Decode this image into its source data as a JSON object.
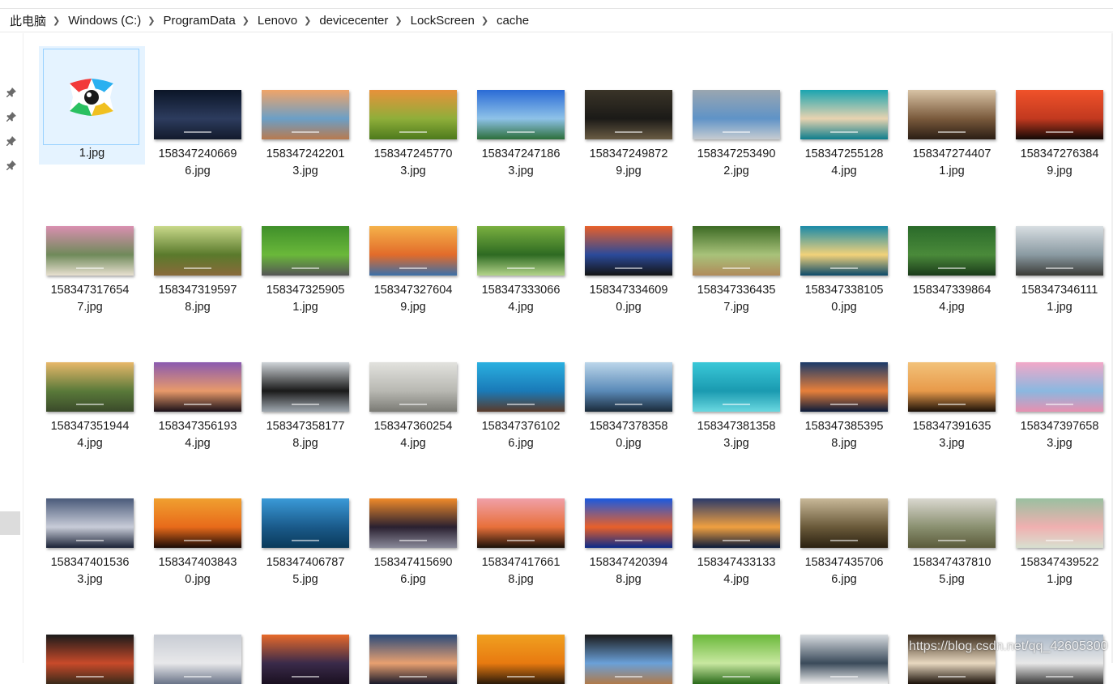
{
  "breadcrumb": [
    {
      "label": "此电脑"
    },
    {
      "label": "Windows (C:)"
    },
    {
      "label": "ProgramData"
    },
    {
      "label": "Lenovo"
    },
    {
      "label": "devicecenter"
    },
    {
      "label": "LockScreen"
    },
    {
      "label": "cache"
    }
  ],
  "selected_file": {
    "name": "1.jpg"
  },
  "files": [
    {
      "l1": "158347240669",
      "l2": "6.jpg",
      "c1": "#0b1527",
      "c2": "#2d3c5e",
      "c3": "#121a2c"
    },
    {
      "l1": "158347242201",
      "l2": "3.jpg",
      "c1": "#f0a468",
      "c2": "#6b9fc7",
      "c3": "#b97a4f"
    },
    {
      "l1": "158347245770",
      "l2": "3.jpg",
      "c1": "#e8913a",
      "c2": "#8fae3a",
      "c3": "#4d7a1c"
    },
    {
      "l1": "158347247186",
      "l2": "3.jpg",
      "c1": "#2a6bd6",
      "c2": "#8ec2e8",
      "c3": "#2c6e3a"
    },
    {
      "l1": "158347249872",
      "l2": "9.jpg",
      "c1": "#3a3428",
      "c2": "#1b1a17",
      "c3": "#6a5c44"
    },
    {
      "l1": "158347253490",
      "l2": "2.jpg",
      "c1": "#9aa6b0",
      "c2": "#5f93c7",
      "c3": "#c6ccd1"
    },
    {
      "l1": "158347255128",
      "l2": "4.jpg",
      "c1": "#1aa4b0",
      "c2": "#e8d3b0",
      "c3": "#0d7d8c"
    },
    {
      "l1": "158347274407",
      "l2": "1.jpg",
      "c1": "#d8c3a5",
      "c2": "#7a5a3c",
      "c3": "#2a1d14"
    },
    {
      "l1": "158347276384",
      "l2": "9.jpg",
      "c1": "#f0522a",
      "c2": "#c2391f",
      "c3": "#120806"
    },
    {
      "l1": "158347317654",
      "l2": "7.jpg",
      "c1": "#d98fb0",
      "c2": "#6f8a5a",
      "c3": "#e8e0d0"
    },
    {
      "l1": "158347319597",
      "l2": "8.jpg",
      "c1": "#c9d98a",
      "c2": "#5a7a2c",
      "c3": "#8a6a3a"
    },
    {
      "l1": "158347325905",
      "l2": "1.jpg",
      "c1": "#3f8f2a",
      "c2": "#6ab83a",
      "c3": "#555555"
    },
    {
      "l1": "158347327604",
      "l2": "9.jpg",
      "c1": "#f5b24a",
      "c2": "#e26b2a",
      "c3": "#3a6fa8"
    },
    {
      "l1": "158347333066",
      "l2": "4.jpg",
      "c1": "#7ab040",
      "c2": "#2e6a22",
      "c3": "#b4d48a"
    },
    {
      "l1": "158347334609",
      "l2": "0.jpg",
      "c1": "#e8602a",
      "c2": "#2b4a9a",
      "c3": "#141414"
    },
    {
      "l1": "158347336435",
      "l2": "7.jpg",
      "c1": "#3c6a24",
      "c2": "#a8c27a",
      "c3": "#b08a5a"
    },
    {
      "l1": "158347338105",
      "l2": "0.jpg",
      "c1": "#1a8aa8",
      "c2": "#f2d27a",
      "c3": "#0c4a6a"
    },
    {
      "l1": "158347339864",
      "l2": "4.jpg",
      "c1": "#2a6a2a",
      "c2": "#4a8a3a",
      "c3": "#1a3a1a"
    },
    {
      "l1": "158347346111",
      "l2": "1.jpg",
      "c1": "#d8dee2",
      "c2": "#8a9aa2",
      "c3": "#3a3a36"
    },
    {
      "l1": "158347351944",
      "l2": "4.jpg",
      "c1": "#e8b86a",
      "c2": "#5a7a3a",
      "c3": "#3a4a2a"
    },
    {
      "l1": "158347356193",
      "l2": "4.jpg",
      "c1": "#8a5ab0",
      "c2": "#e89a6a",
      "c3": "#1a1018"
    },
    {
      "l1": "158347358177",
      "l2": "8.jpg",
      "c1": "#cfd4d8",
      "c2": "#1a1a1a",
      "c3": "#a0a8b0"
    },
    {
      "l1": "158347360254",
      "l2": "4.jpg",
      "c1": "#e2e2de",
      "c2": "#b8b8b2",
      "c3": "#7a7a74"
    },
    {
      "l1": "158347376102",
      "l2": "6.jpg",
      "c1": "#2ab0e0",
      "c2": "#1a7ab8",
      "c3": "#5a3a2a"
    },
    {
      "l1": "158347378358",
      "l2": "0.jpg",
      "c1": "#bcd6ea",
      "c2": "#5a8ab8",
      "c3": "#1a2a3a"
    },
    {
      "l1": "158347381358",
      "l2": "3.jpg",
      "c1": "#3ac8d8",
      "c2": "#1a9ab0",
      "c3": "#6ad8e0"
    },
    {
      "l1": "158347385395",
      "l2": "8.jpg",
      "c1": "#1a3a6a",
      "c2": "#e8803a",
      "c3": "#0a1a3a"
    },
    {
      "l1": "158347391635",
      "l2": "3.jpg",
      "c1": "#f2c27a",
      "c2": "#e89a4a",
      "c3": "#1a1008"
    },
    {
      "l1": "158347397658",
      "l2": "3.jpg",
      "c1": "#f2a8c8",
      "c2": "#8ab8e0",
      "c3": "#e890b0"
    },
    {
      "l1": "158347401536",
      "l2": "3.jpg",
      "c1": "#4a5a7a",
      "c2": "#c8ccd8",
      "c3": "#1a2236"
    },
    {
      "l1": "158347403843",
      "l2": "0.jpg",
      "c1": "#f0a030",
      "c2": "#e86a1a",
      "c3": "#1a0a06"
    },
    {
      "l1": "158347406787",
      "l2": "5.jpg",
      "c1": "#3a9ad8",
      "c2": "#1a5a8a",
      "c3": "#0a3a5a"
    },
    {
      "l1": "158347415690",
      "l2": "6.jpg",
      "c1": "#f08a2a",
      "c2": "#2a2030",
      "c3": "#8a8a9a"
    },
    {
      "l1": "158347417661",
      "l2": "8.jpg",
      "c1": "#f0a0a8",
      "c2": "#e8703a",
      "c3": "#1a1008"
    },
    {
      "l1": "158347420394",
      "l2": "8.jpg",
      "c1": "#1a5ae0",
      "c2": "#e8602a",
      "c3": "#0a2a8a"
    },
    {
      "l1": "158347433133",
      "l2": "4.jpg",
      "c1": "#2a3a6a",
      "c2": "#f0a040",
      "c3": "#0a1a3a"
    },
    {
      "l1": "158347435706",
      "l2": "6.jpg",
      "c1": "#c8b898",
      "c2": "#6a5a3a",
      "c3": "#2a2010"
    },
    {
      "l1": "158347437810",
      "l2": "5.jpg",
      "c1": "#dad8d0",
      "c2": "#8a9070",
      "c3": "#5a5a3a"
    },
    {
      "l1": "158347439522",
      "l2": "1.jpg",
      "c1": "#9ac0a0",
      "c2": "#f0b0b0",
      "c3": "#d8e0d0"
    },
    {
      "l1": "",
      "l2": "",
      "c1": "#1a1a1a",
      "c2": "#c84a2a",
      "c3": "#3a2a1a"
    },
    {
      "l1": "",
      "l2": "",
      "c1": "#c8ccd4",
      "c2": "#e8e8ea",
      "c3": "#6a7488"
    },
    {
      "l1": "",
      "l2": "",
      "c1": "#e86a2a",
      "c2": "#3a2a4a",
      "c3": "#1a1020"
    },
    {
      "l1": "",
      "l2": "",
      "c1": "#2a4a7a",
      "c2": "#e8a070",
      "c3": "#1a1a2a"
    },
    {
      "l1": "",
      "l2": "",
      "c1": "#f0a020",
      "c2": "#e87a10",
      "c3": "#2a1a0a"
    },
    {
      "l1": "",
      "l2": "",
      "c1": "#1a1a1a",
      "c2": "#6aa0d8",
      "c3": "#b07a4a"
    },
    {
      "l1": "",
      "l2": "",
      "c1": "#6ab83a",
      "c2": "#c8e8a0",
      "c3": "#2a6a1a"
    },
    {
      "l1": "",
      "l2": "",
      "c1": "#d8dce0",
      "c2": "#3a4a5a",
      "c3": "#f0f0f0"
    },
    {
      "l1": "",
      "l2": "",
      "c1": "#3a2a1a",
      "c2": "#e8d8c0",
      "c3": "#1a1008"
    },
    {
      "l1": "",
      "l2": "",
      "c1": "#aab8c8",
      "c2": "#e8e8e8",
      "c3": "#3a3a3a"
    }
  ],
  "watermark": "https://blog.csdn.net/qq_42605300"
}
